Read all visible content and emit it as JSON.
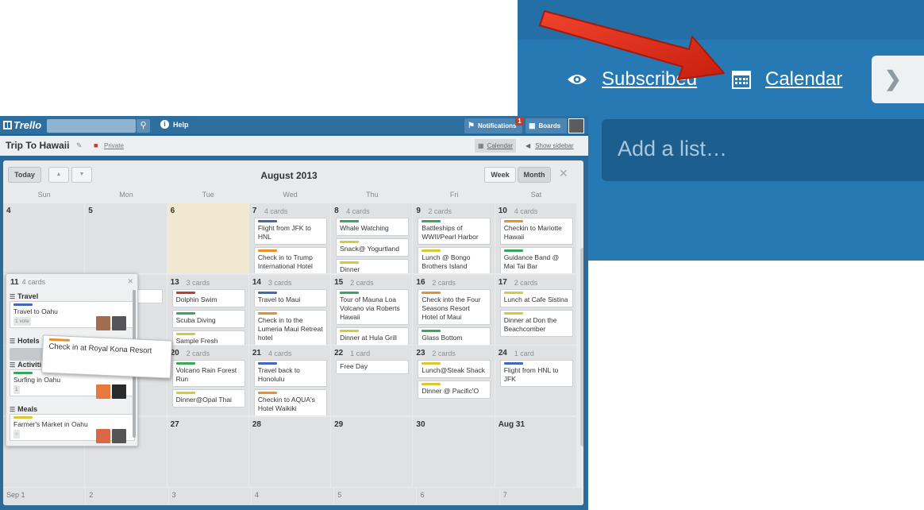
{
  "zoom": {
    "subscribed_label": "Subscribed",
    "calendar_label": "Calendar",
    "add_list_placeholder": "Add a list…",
    "arrow_color": "#e0301e"
  },
  "topbar": {
    "logo_text": "Trello",
    "help_label": "Help",
    "notifications_label": "Notifications",
    "notifications_count": "1",
    "boards_label": "Boards"
  },
  "board": {
    "title": "Trip To Hawaii",
    "privacy": "Private",
    "calendar_btn": "Calendar",
    "show_sidebar": "Show sidebar"
  },
  "calendar": {
    "today_label": "Today",
    "month_title": "August 2013",
    "week_label": "Week",
    "month_label": "Month",
    "days_of_week": [
      "Sun",
      "Mon",
      "Tue",
      "Wed",
      "Thu",
      "Fri",
      "Sat"
    ],
    "weeks": [
      [
        {
          "date": "4",
          "count": "",
          "cards": []
        },
        {
          "date": "5",
          "count": "",
          "cards": []
        },
        {
          "date": "6",
          "count": "",
          "today": true,
          "cards": []
        },
        {
          "date": "7",
          "count": "4 cards",
          "cards": [
            {
              "label": "#3f68b8",
              "text": "Flight from JFK to HNL"
            },
            {
              "label": "#e8902e",
              "text": "Check in to Trump International Hotel"
            }
          ]
        },
        {
          "date": "8",
          "count": "4 cards",
          "cards": [
            {
              "label": "#3aa55d",
              "text": "Whale Watching"
            },
            {
              "label": "#d6c93a",
              "text": "Snack@ Yogurtland"
            },
            {
              "label": "#d6c93a",
              "text": "Dinner"
            }
          ]
        },
        {
          "date": "9",
          "count": "2 cards",
          "cards": [
            {
              "label": "#3aa55d",
              "text": "Battleships of WWII/Pearl Harbor"
            },
            {
              "label": "#d6c93a",
              "text": "Lunch @ Bongo Brothers Island"
            }
          ]
        },
        {
          "date": "10",
          "count": "4 cards",
          "cards": [
            {
              "label": "#e8902e",
              "text": "Checkin to Mariotte Hawaii"
            },
            {
              "label": "#3aa55d",
              "text": "Guidance Band @ Mai Tai Bar"
            }
          ]
        }
      ],
      [
        {
          "date": "11",
          "count": "",
          "cards": []
        },
        {
          "date": "12",
          "count": "",
          "cards": [
            {
              "label": "",
              "text": "ka"
            }
          ]
        },
        {
          "date": "13",
          "count": "3 cards",
          "cards": [
            {
              "label": "#c63a2b",
              "text": "Dolphin Swim"
            },
            {
              "label": "#3aa55d",
              "text": "Scuba Diving"
            },
            {
              "label": "#d6c93a",
              "text": "Sample Fresh"
            }
          ]
        },
        {
          "date": "14",
          "count": "3 cards",
          "cards": [
            {
              "label": "#3f68b8",
              "text": "Travel to Maui"
            },
            {
              "label": "#e8902e",
              "text": "Check in to the Lumeria Maui Retreat hotel"
            }
          ]
        },
        {
          "date": "15",
          "count": "2 cards",
          "cards": [
            {
              "label": "#3aa55d",
              "text": "Tour of Mauna Loa Volcano via Roberts Hawaii"
            },
            {
              "label": "#d6c93a",
              "text": "Dinner at Hula Grill"
            }
          ]
        },
        {
          "date": "16",
          "count": "2 cards",
          "cards": [
            {
              "label": "#e8902e",
              "text": "Check into the Four Seasons Resort Hotel of Maui"
            },
            {
              "label": "#3aa55d",
              "text": "Glass Bottom"
            }
          ]
        },
        {
          "date": "17",
          "count": "2 cards",
          "cards": [
            {
              "label": "#d6c93a",
              "text": "Lunch at Cafe Sistina"
            },
            {
              "label": "#d6c93a",
              "text": "Dinner at Don the Beachcomber"
            }
          ]
        }
      ],
      [
        {
          "date": "18",
          "count": "",
          "cards": []
        },
        {
          "date": "19",
          "count": "",
          "cards": [
            {
              "label": "",
              "text": "otel"
            }
          ]
        },
        {
          "date": "20",
          "count": "2 cards",
          "cards": [
            {
              "label": "#3aa55d",
              "text": "Volcano Rain Forest Run"
            },
            {
              "label": "#d6c93a",
              "text": "Dinner@Opal Thai"
            }
          ]
        },
        {
          "date": "21",
          "count": "4 cards",
          "cards": [
            {
              "label": "#3f68b8",
              "text": "Travel back to Honolulu"
            },
            {
              "label": "#e8902e",
              "text": "Checkin to AQUA's Hotel Waikiki"
            }
          ]
        },
        {
          "date": "22",
          "count": "1 card",
          "cards": [
            {
              "label": "",
              "text": "Free Day"
            }
          ]
        },
        {
          "date": "23",
          "count": "2 cards",
          "cards": [
            {
              "label": "#d6c93a",
              "text": "Lunch@Steak Shack"
            },
            {
              "label": "#d6c93a",
              "text": "Dinner @ Pacific'O"
            }
          ]
        },
        {
          "date": "24",
          "count": "1 card",
          "cards": [
            {
              "label": "#3f68b8",
              "text": "Flight from HNL to JFK"
            }
          ]
        }
      ],
      [
        {
          "date": "25",
          "count": "",
          "cards": []
        },
        {
          "date": "26",
          "count": "",
          "cards": []
        },
        {
          "date": "27",
          "count": "",
          "cards": []
        },
        {
          "date": "28",
          "count": "",
          "cards": []
        },
        {
          "date": "29",
          "count": "",
          "cards": []
        },
        {
          "date": "30",
          "count": "",
          "cards": []
        },
        {
          "date": "Aug 31",
          "count": "",
          "cards": []
        }
      ]
    ],
    "next_row": [
      "Sep 1",
      "2",
      "3",
      "4",
      "5",
      "6",
      "7"
    ]
  },
  "popover": {
    "date": "11",
    "count": "4 cards",
    "groups": [
      {
        "title": "Travel",
        "cards": [
          {
            "label": "#3f68b8",
            "text": "Travel to Oahu",
            "badges": [
              "1 vote"
            ]
          }
        ]
      },
      {
        "title": "Hotels",
        "cards": []
      },
      {
        "title": "Activities",
        "cards": [
          {
            "label": "#3aa55d",
            "text": "Surfing in Oahu",
            "badges": [
              "1"
            ]
          }
        ]
      },
      {
        "title": "Meals",
        "cards": [
          {
            "label": "#d6c93a",
            "text": "Farmer's Market in Oahu",
            "badges": [
              ""
            ]
          }
        ]
      }
    ]
  },
  "drag_card": {
    "text": "Check in at Royal Kona Resort"
  }
}
